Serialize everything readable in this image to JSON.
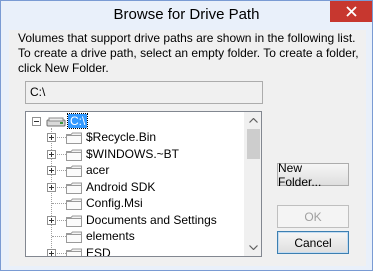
{
  "window": {
    "title": "Browse for Drive Path",
    "close_icon": "close-icon"
  },
  "description": {
    "line1": "Volumes that support drive paths are shown in the following list.",
    "line2": "To create a drive path, select an empty folder. To create a folder,",
    "line3": "click New Folder."
  },
  "path_field": {
    "value": "C:\\"
  },
  "tree": {
    "root": {
      "label": "C:\\",
      "icon": "drive-icon",
      "expanded": true,
      "selected": true
    },
    "items": [
      {
        "label": "$Recycle.Bin",
        "has_children": true
      },
      {
        "label": "$WINDOWS.~BT",
        "has_children": true
      },
      {
        "label": "acer",
        "has_children": true
      },
      {
        "label": "Android SDK",
        "has_children": true
      },
      {
        "label": "Config.Msi",
        "has_children": false
      },
      {
        "label": "Documents and Settings",
        "has_children": true
      },
      {
        "label": "elements",
        "has_children": false
      },
      {
        "label": "ESD",
        "has_children": true
      }
    ]
  },
  "buttons": {
    "new_folder": "New Folder...",
    "ok": "OK",
    "cancel": "Cancel"
  },
  "colors": {
    "selection": "#3399ff",
    "close_button": "#c7372f",
    "title_background": "#e9f0fa"
  }
}
